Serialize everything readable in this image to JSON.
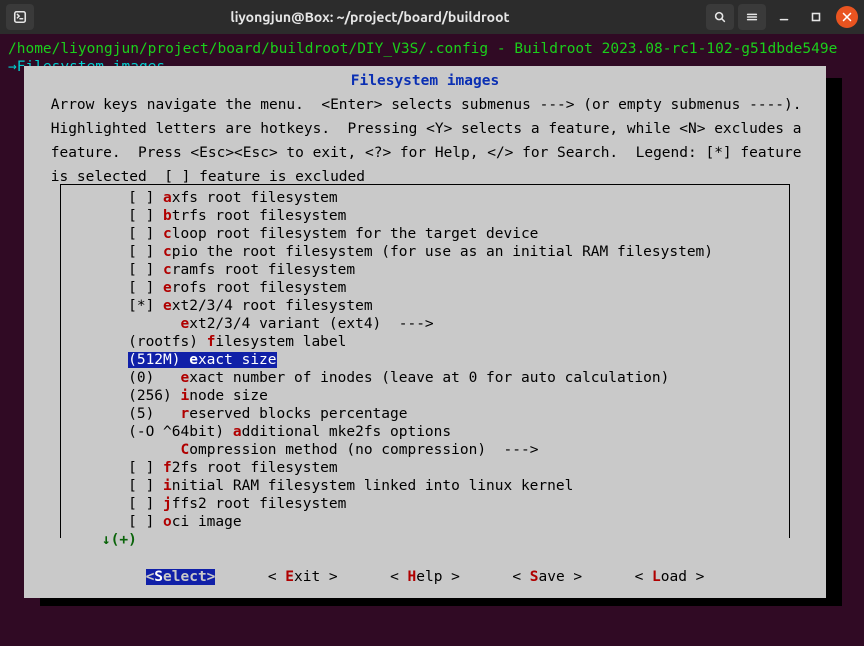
{
  "window": {
    "title": "liyongjun@Box: ~/project/board/buildroot"
  },
  "term": {
    "path_line": "/home/liyongjun/project/board/buildroot/DIY_V3S/.config - Buildroot 2023.08-rc1-102-g51dbde549e",
    "crumb_arrow": "→",
    "crumb": "Filesystem images"
  },
  "dialog": {
    "title": "Filesystem images",
    "help1": " Arrow keys navigate the menu.  <Enter> selects submenus ---> (or empty submenus ----).",
    "help2": " Highlighted letters are hotkeys.  Pressing <Y> selects a feature, while <N> excludes a",
    "help3": " feature.  Press <Esc><Esc> to exit, <?> for Help, </> for Search.  Legend: [*] feature",
    "help4": " is selected  [ ] feature is excluded",
    "items": [
      {
        "mark": "[ ]",
        "hot": "a",
        "rest": "xfs root filesystem"
      },
      {
        "mark": "[ ]",
        "hot": "b",
        "rest": "trfs root filesystem"
      },
      {
        "mark": "[ ]",
        "hot": "c",
        "rest": "loop root filesystem for the target device"
      },
      {
        "mark": "[ ]",
        "hot": "c",
        "rest": "pio the root filesystem (for use as an initial RAM filesystem)"
      },
      {
        "mark": "[ ]",
        "hot": "c",
        "rest": "ramfs root filesystem"
      },
      {
        "mark": "[ ]",
        "hot": "e",
        "rest": "rofs root filesystem"
      },
      {
        "mark": "[*]",
        "hot": "e",
        "rest": "xt2/3/4 root filesystem"
      },
      {
        "mark": "   ",
        "hot": "e",
        "rest": "xt2/3/4 variant (ext4)  --->",
        "indent": "  "
      },
      {
        "mark": "(rootfs)",
        "hot": "f",
        "rest": "ilesystem label",
        "plain_mark": true
      },
      {
        "mark": "(512M)",
        "hot": "e",
        "rest": "xact size",
        "selected": true,
        "plain_mark": true
      },
      {
        "mark": "(0)",
        "hot": "e",
        "rest": "xact number of inodes (leave at 0 for auto calculation)",
        "plain_mark": true,
        "pad": "   "
      },
      {
        "mark": "(256)",
        "hot": "i",
        "rest": "node size",
        "plain_mark": true,
        "pad": " "
      },
      {
        "mark": "(5)",
        "hot": "r",
        "rest": "eserved blocks percentage",
        "plain_mark": true,
        "pad": "   "
      },
      {
        "mark": "(-O ^64bit)",
        "hot": "a",
        "rest": "dditional mke2fs options",
        "plain_mark": true
      },
      {
        "mark": "   ",
        "hot": "C",
        "rest": "ompression method (no compression)  --->",
        "indent": "  "
      },
      {
        "mark": "[ ]",
        "hot": "f",
        "rest": "2fs root filesystem"
      },
      {
        "mark": "[ ]",
        "hot": "i",
        "rest": "nitial RAM filesystem linked into linux kernel"
      },
      {
        "mark": "[ ]",
        "hot": "j",
        "rest": "ffs2 root filesystem"
      },
      {
        "mark": "[ ]",
        "hot": "o",
        "rest": "ci image"
      }
    ],
    "scroll_hint_glyph": "↓",
    "scroll_hint_text": "(+)",
    "buttons": {
      "select": {
        "full": "<Select>",
        "hot": "S",
        "before": "<",
        "mid": "elect>"
      },
      "exit": {
        "before": "< ",
        "hot": "E",
        "mid": "xit >"
      },
      "help": {
        "before": "< ",
        "hot": "H",
        "mid": "elp >"
      },
      "save": {
        "before": "< ",
        "hot": "S",
        "mid": "ave >"
      },
      "load": {
        "before": "< ",
        "hot": "L",
        "mid": "oad >"
      }
    }
  }
}
